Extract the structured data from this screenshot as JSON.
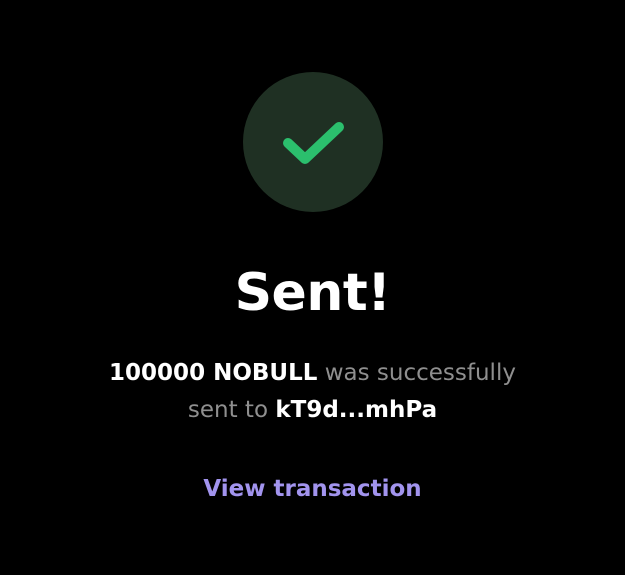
{
  "colors": {
    "background": "#000000",
    "icon_circle": "#1f3023",
    "check": "#2bbf6d",
    "title": "#ffffff",
    "muted_text": "#8f8f8f",
    "link": "#a294ee"
  },
  "status": {
    "icon": "checkmark-icon",
    "title": "Sent!"
  },
  "message": {
    "amount": "100000 NOBULL",
    "middle": " was successfully",
    "prefix": "sent to ",
    "recipient": "kT9d...mhPa"
  },
  "actions": {
    "view_transaction": "View transaction"
  }
}
